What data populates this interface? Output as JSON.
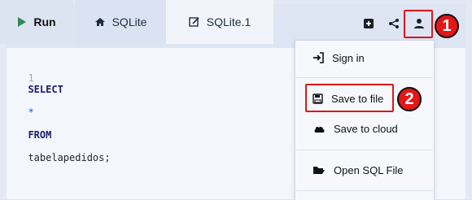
{
  "tabs": {
    "run_label": "Run",
    "sqlite_label": "SQLite",
    "sqlite1_label": "SQLite.1"
  },
  "editor": {
    "line_number": "1",
    "kw_select": "SELECT",
    "star": "*",
    "kw_from": "FROM",
    "table": "tabelapedidos;"
  },
  "toolbar": {
    "icons": [
      "plus-square-icon",
      "share-icon",
      "user-icon"
    ]
  },
  "menu": {
    "items": [
      {
        "label": "Sign in",
        "icon": "sign-in-icon"
      },
      {
        "label": "Save to file",
        "icon": "floppy-disk-icon"
      },
      {
        "label": "Save to cloud",
        "icon": "cloud-icon"
      },
      {
        "label": "Open SQL File",
        "icon": "folder-open-icon"
      }
    ]
  },
  "callouts": {
    "badge1": "1",
    "badge2": "2",
    "color": "#e51616"
  }
}
